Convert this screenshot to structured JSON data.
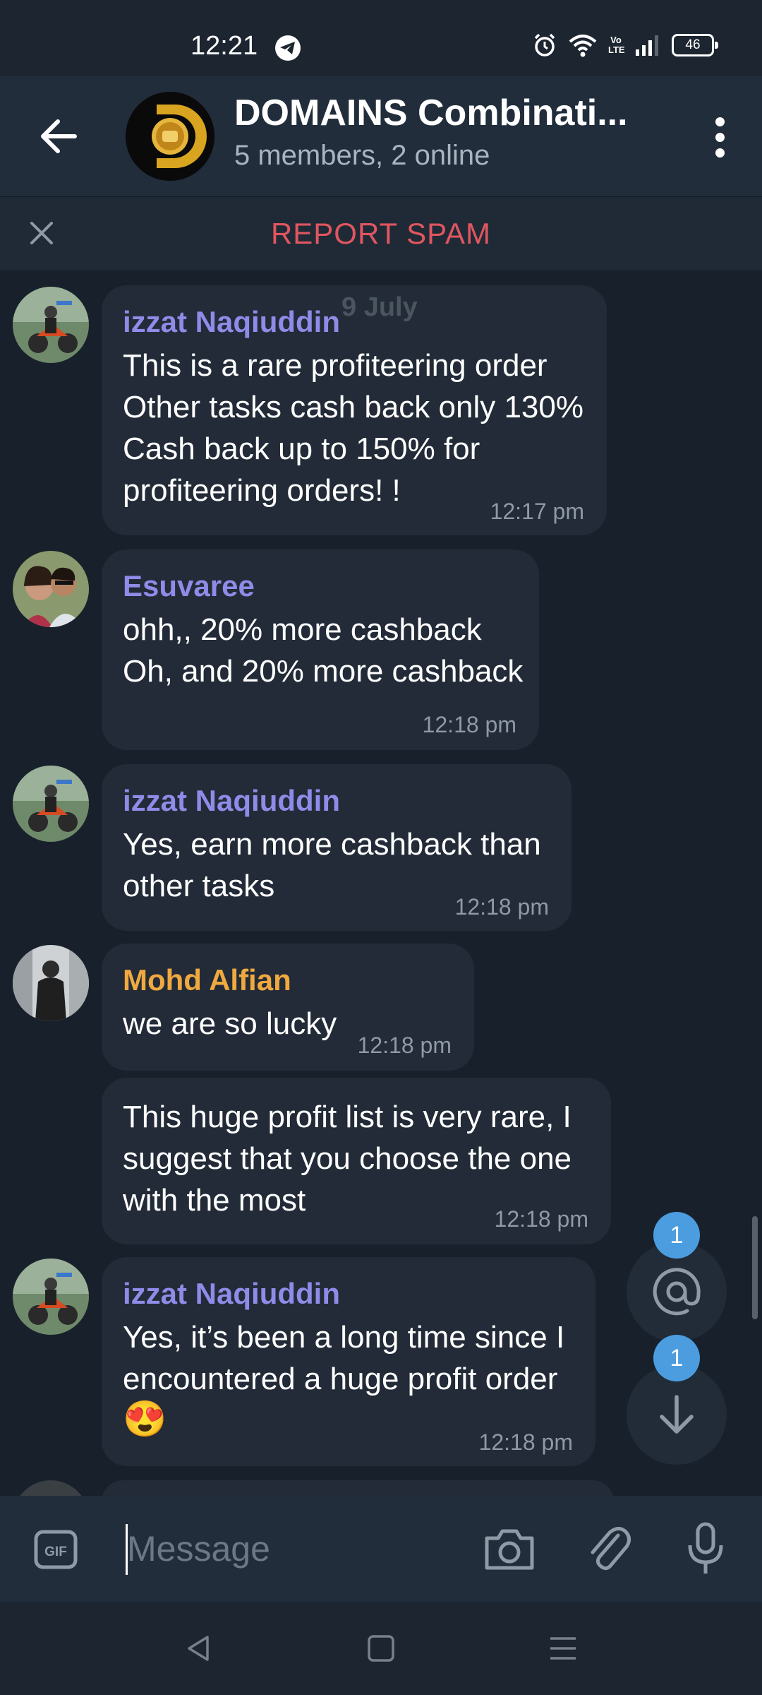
{
  "status_bar": {
    "time": "12:21",
    "battery": "46",
    "volte": "Vo\nLTE"
  },
  "header": {
    "title": "DOMAINS Combinati...",
    "subtitle": "5 members, 2 online"
  },
  "spam_bar": {
    "label": "REPORT SPAM"
  },
  "date_chip": "9 July",
  "messages": [
    {
      "sender": "izzat Naqiuddin",
      "sender_color": "#8f8be8",
      "text": "This is a rare profiteering order\nOther tasks cash back only 130%\nCash back up to 150% for\nprofiteering orders! !",
      "time": "12:17 pm"
    },
    {
      "sender": "Esuvaree",
      "sender_color": "#8f8be8",
      "text": "ohh,, 20% more cashback\nOh, and 20% more cashback",
      "time": "12:18 pm"
    },
    {
      "sender": "izzat Naqiuddin",
      "sender_color": "#8f8be8",
      "text": "Yes, earn more cashback than\nother tasks",
      "time": "12:18 pm"
    },
    {
      "sender": "Mohd Alfian",
      "sender_color": "#f0a93f",
      "text": "we are so lucky",
      "time": "12:18 pm"
    },
    {
      "sender": "",
      "text": "This huge profit list is very rare, I\nsuggest that you choose the one\nwith the most",
      "time": "12:18 pm"
    },
    {
      "sender": "izzat Naqiuddin",
      "sender_color": "#8f8be8",
      "text": "Yes, it’s been a long time since I\nencountered a huge profit order",
      "emoji": "😍",
      "time": "12:18 pm"
    }
  ],
  "fab": {
    "mention_count": "1",
    "down_count": "1"
  },
  "input": {
    "placeholder": "Message",
    "gif_label": "GIF"
  }
}
